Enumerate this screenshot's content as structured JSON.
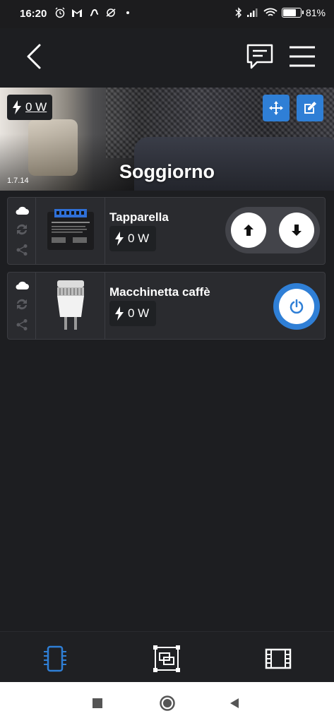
{
  "status_bar": {
    "time": "16:20",
    "battery": "81%",
    "battery_level": 0.81,
    "left_icons": [
      "alarm-icon",
      "gmail-icon",
      "notification-icon",
      "crossed-icon",
      "dot"
    ],
    "right_icons": [
      "bluetooth-icon",
      "signal-icon",
      "wifi-icon",
      "battery-icon"
    ]
  },
  "app_bar": {
    "back_icon": "chevron-left-icon",
    "message_icon": "message-icon",
    "menu_icon": "menu-icon"
  },
  "room": {
    "name": "Soggiorno",
    "power_value": "0 W",
    "version": "1.7.14",
    "move_icon": "move-icon",
    "edit_icon": "edit-icon"
  },
  "devices": [
    {
      "name": "Tapparella",
      "power": "0 W",
      "type": "shutter",
      "status_icons": [
        "cloud-icon",
        "sync-icon",
        "share-icon"
      ]
    },
    {
      "name": "Macchinetta caffè",
      "power": "0 W",
      "type": "plug",
      "status_icons": [
        "cloud-icon",
        "sync-icon",
        "share-icon"
      ]
    }
  ],
  "bottom_nav": {
    "items": [
      "devices-icon",
      "rooms-icon",
      "scenes-icon"
    ],
    "active": "devices-icon"
  },
  "colors": {
    "accent": "#2f7fd6",
    "background": "#1d1e21",
    "card": "#2a2b2f"
  }
}
